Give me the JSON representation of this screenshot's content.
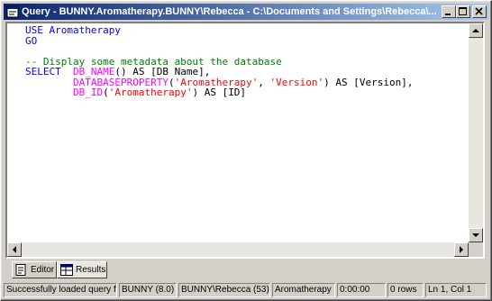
{
  "window": {
    "title": "Query - BUNNY.Aromatherapy.BUNNY\\Rebecca - C:\\Documents and Settings\\Rebecca\\..."
  },
  "editor": {
    "line1": "USE Aromatherapy",
    "line2": "GO",
    "line3": "-- Display some metadata about the database",
    "line4_kw": "SELECT",
    "line4_fn": "DB_NAME",
    "line4_rest": "() AS [DB Name],",
    "line5_fn": "DATABASEPROPERTY",
    "line5_p1": "(",
    "line5_s1": "'Aromatherapy'",
    "line5_p2": ", ",
    "line5_s2": "'Version'",
    "line5_p3": ") AS [Version],",
    "line6_fn": "DB_ID",
    "line6_p1": "(",
    "line6_s1": "'Aromatherapy'",
    "line6_p2": ") AS [ID]"
  },
  "tabs": {
    "editor": "Editor",
    "results": "Results"
  },
  "status": {
    "message": "Successfully loaded query fil",
    "server": "BUNNY (8.0)",
    "user": "BUNNY\\Rebecca (53)",
    "database": "Aromatherapy",
    "elapsed": "0:00:00",
    "rows": "0 rows",
    "position": "Ln 1, Col 1"
  },
  "icons": [
    "query-window-icon",
    "minimize-icon",
    "maximize-icon",
    "close-icon",
    "scroll-up-icon",
    "scroll-down-icon",
    "scroll-left-icon",
    "scroll-right-icon",
    "editor-tab-icon",
    "results-tab-icon"
  ]
}
